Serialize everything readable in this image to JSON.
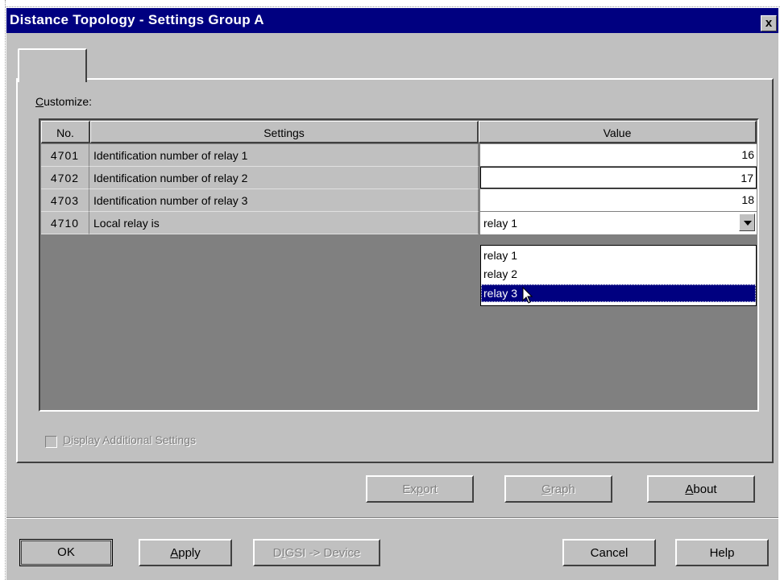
{
  "window": {
    "title": "Distance Topology - Settings Group A",
    "close_label": "x"
  },
  "customize_label_mnemonic": "C",
  "customize_label_rest": "ustomize:",
  "grid": {
    "headers": {
      "no": "No.",
      "settings": "Settings",
      "value": "Value"
    },
    "rows": [
      {
        "no": "4701",
        "setting": "Identification number of relay 1",
        "value": "16"
      },
      {
        "no": "4702",
        "setting": "Identification number of relay 2",
        "value": "17"
      },
      {
        "no": "4703",
        "setting": "Identification number of relay 3",
        "value": "18"
      },
      {
        "no": "4710",
        "setting": "Local relay is",
        "value": "relay 1"
      }
    ]
  },
  "dropdown": {
    "options": [
      "relay 1",
      "relay 2",
      "relay 3"
    ],
    "highlighted": "relay 3"
  },
  "checkbox": {
    "mnemonic": "D",
    "label_rest": "isplay Additional Settings",
    "checked": false,
    "enabled": false
  },
  "buttons": {
    "export": {
      "pre": "Ex",
      "mnemonic": "p",
      "post": "ort"
    },
    "graph": {
      "mnemonic": "G",
      "post": "raph"
    },
    "about": {
      "mnemonic": "A",
      "post": "bout"
    },
    "ok": "OK",
    "apply": {
      "mnemonic": "A",
      "post": "pply"
    },
    "digsi": {
      "pre": "D",
      "mnemonic": "I",
      "post": "GSI -> Device"
    },
    "cancel": "Cancel",
    "help": "Help"
  },
  "colors": {
    "title_bar": "#000080",
    "dialog_face": "#c0c0c0",
    "grid_background": "#808080",
    "selection": "#000080"
  }
}
